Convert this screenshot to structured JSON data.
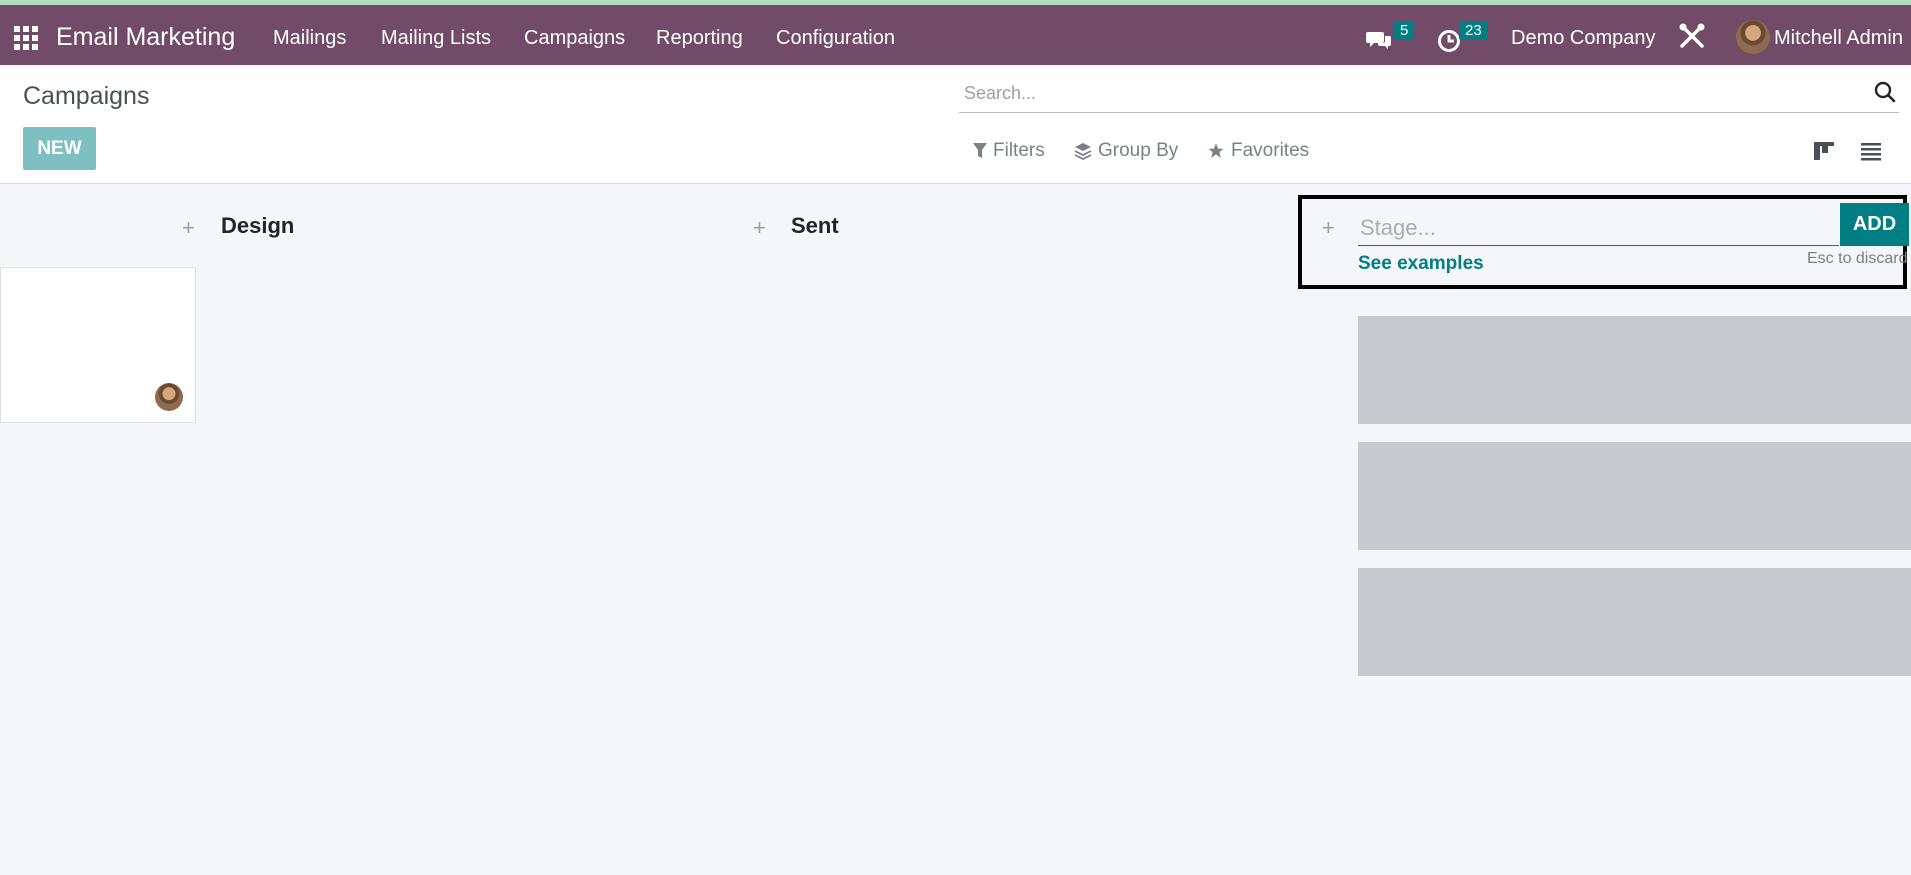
{
  "navbar": {
    "app_name": "Email Marketing",
    "menu": [
      "Mailings",
      "Mailing Lists",
      "Campaigns",
      "Reporting",
      "Configuration"
    ],
    "messages_count": "5",
    "activities_count": "23",
    "company": "Demo Company",
    "user": "Mitchell Admin",
    "bg_color": "#714b67",
    "badge_color": "#017e84"
  },
  "control_panel": {
    "title": "Campaigns",
    "new_label": "NEW",
    "search_placeholder": "Search...",
    "filters_label": "Filters",
    "group_by_label": "Group By",
    "favorites_label": "Favorites"
  },
  "kanban": {
    "columns": [
      "Design",
      "Sent"
    ],
    "new_stage": {
      "placeholder": "Stage...",
      "add_label": "ADD",
      "examples_label": "See examples",
      "esc_hint": "Esc to discard"
    }
  }
}
